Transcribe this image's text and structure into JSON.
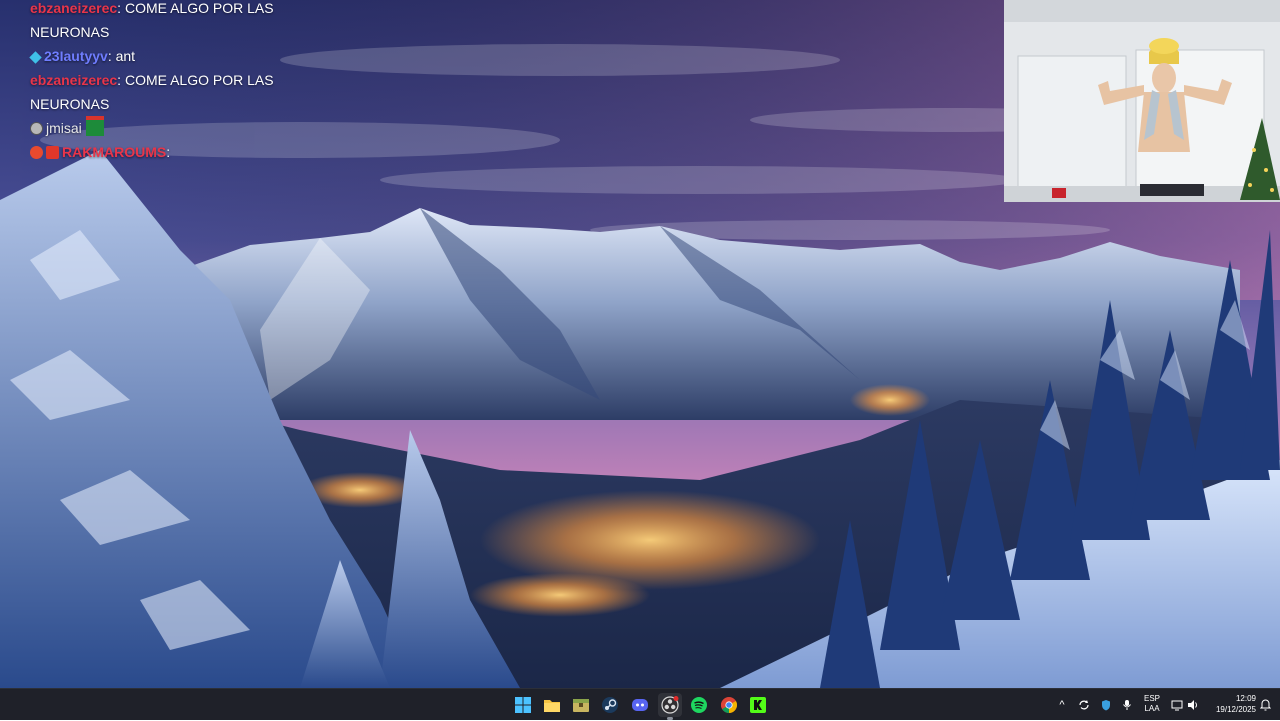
{
  "chat": {
    "messages": [
      {
        "user": "ebzaneizerec",
        "sep": ":",
        "text": "COME ALGO POR LAS NEURONAS",
        "user_color": "#e8354a"
      },
      {
        "user": "23Iautyyv",
        "sep": ":",
        "text": "ant",
        "user_color": "#6f7dff",
        "badge": "diamond-badge"
      },
      {
        "user": "ebzaneizerec",
        "sep": ":",
        "text": "COME ALGO POR LAS NEURONAS",
        "user_color": "#e8354a"
      },
      {
        "user": "jmisai",
        "sep": "",
        "text": "",
        "user_color": "#e8e8e8",
        "badge": "circle-badge",
        "emote": "gift-emote"
      },
      {
        "user": "RAKMAROUMS",
        "sep": ":",
        "text": "",
        "user_color": "#e8354a",
        "badge": "double-badge"
      }
    ]
  },
  "taskbar": {
    "apps": [
      {
        "name": "start-button",
        "icon": "windows-logo-icon"
      },
      {
        "name": "file-explorer",
        "icon": "folder-icon"
      },
      {
        "name": "archive-app",
        "icon": "archive-icon"
      },
      {
        "name": "steam",
        "icon": "steam-icon"
      },
      {
        "name": "discord",
        "icon": "discord-icon"
      },
      {
        "name": "obs-studio",
        "icon": "obs-icon",
        "active": true
      },
      {
        "name": "spotify",
        "icon": "spotify-icon"
      },
      {
        "name": "chrome",
        "icon": "chrome-icon"
      },
      {
        "name": "kick",
        "icon": "kick-icon"
      }
    ],
    "tray": {
      "chevron": "^",
      "language": "ESP",
      "layout": "LAA",
      "time": "12:09",
      "date": "19/12/2025"
    }
  },
  "colors": {
    "taskbar_bg": "#1f2129",
    "sky_top": "#3a3f86",
    "sky_pink": "#d978a8",
    "snow": "#e8f0ff"
  }
}
